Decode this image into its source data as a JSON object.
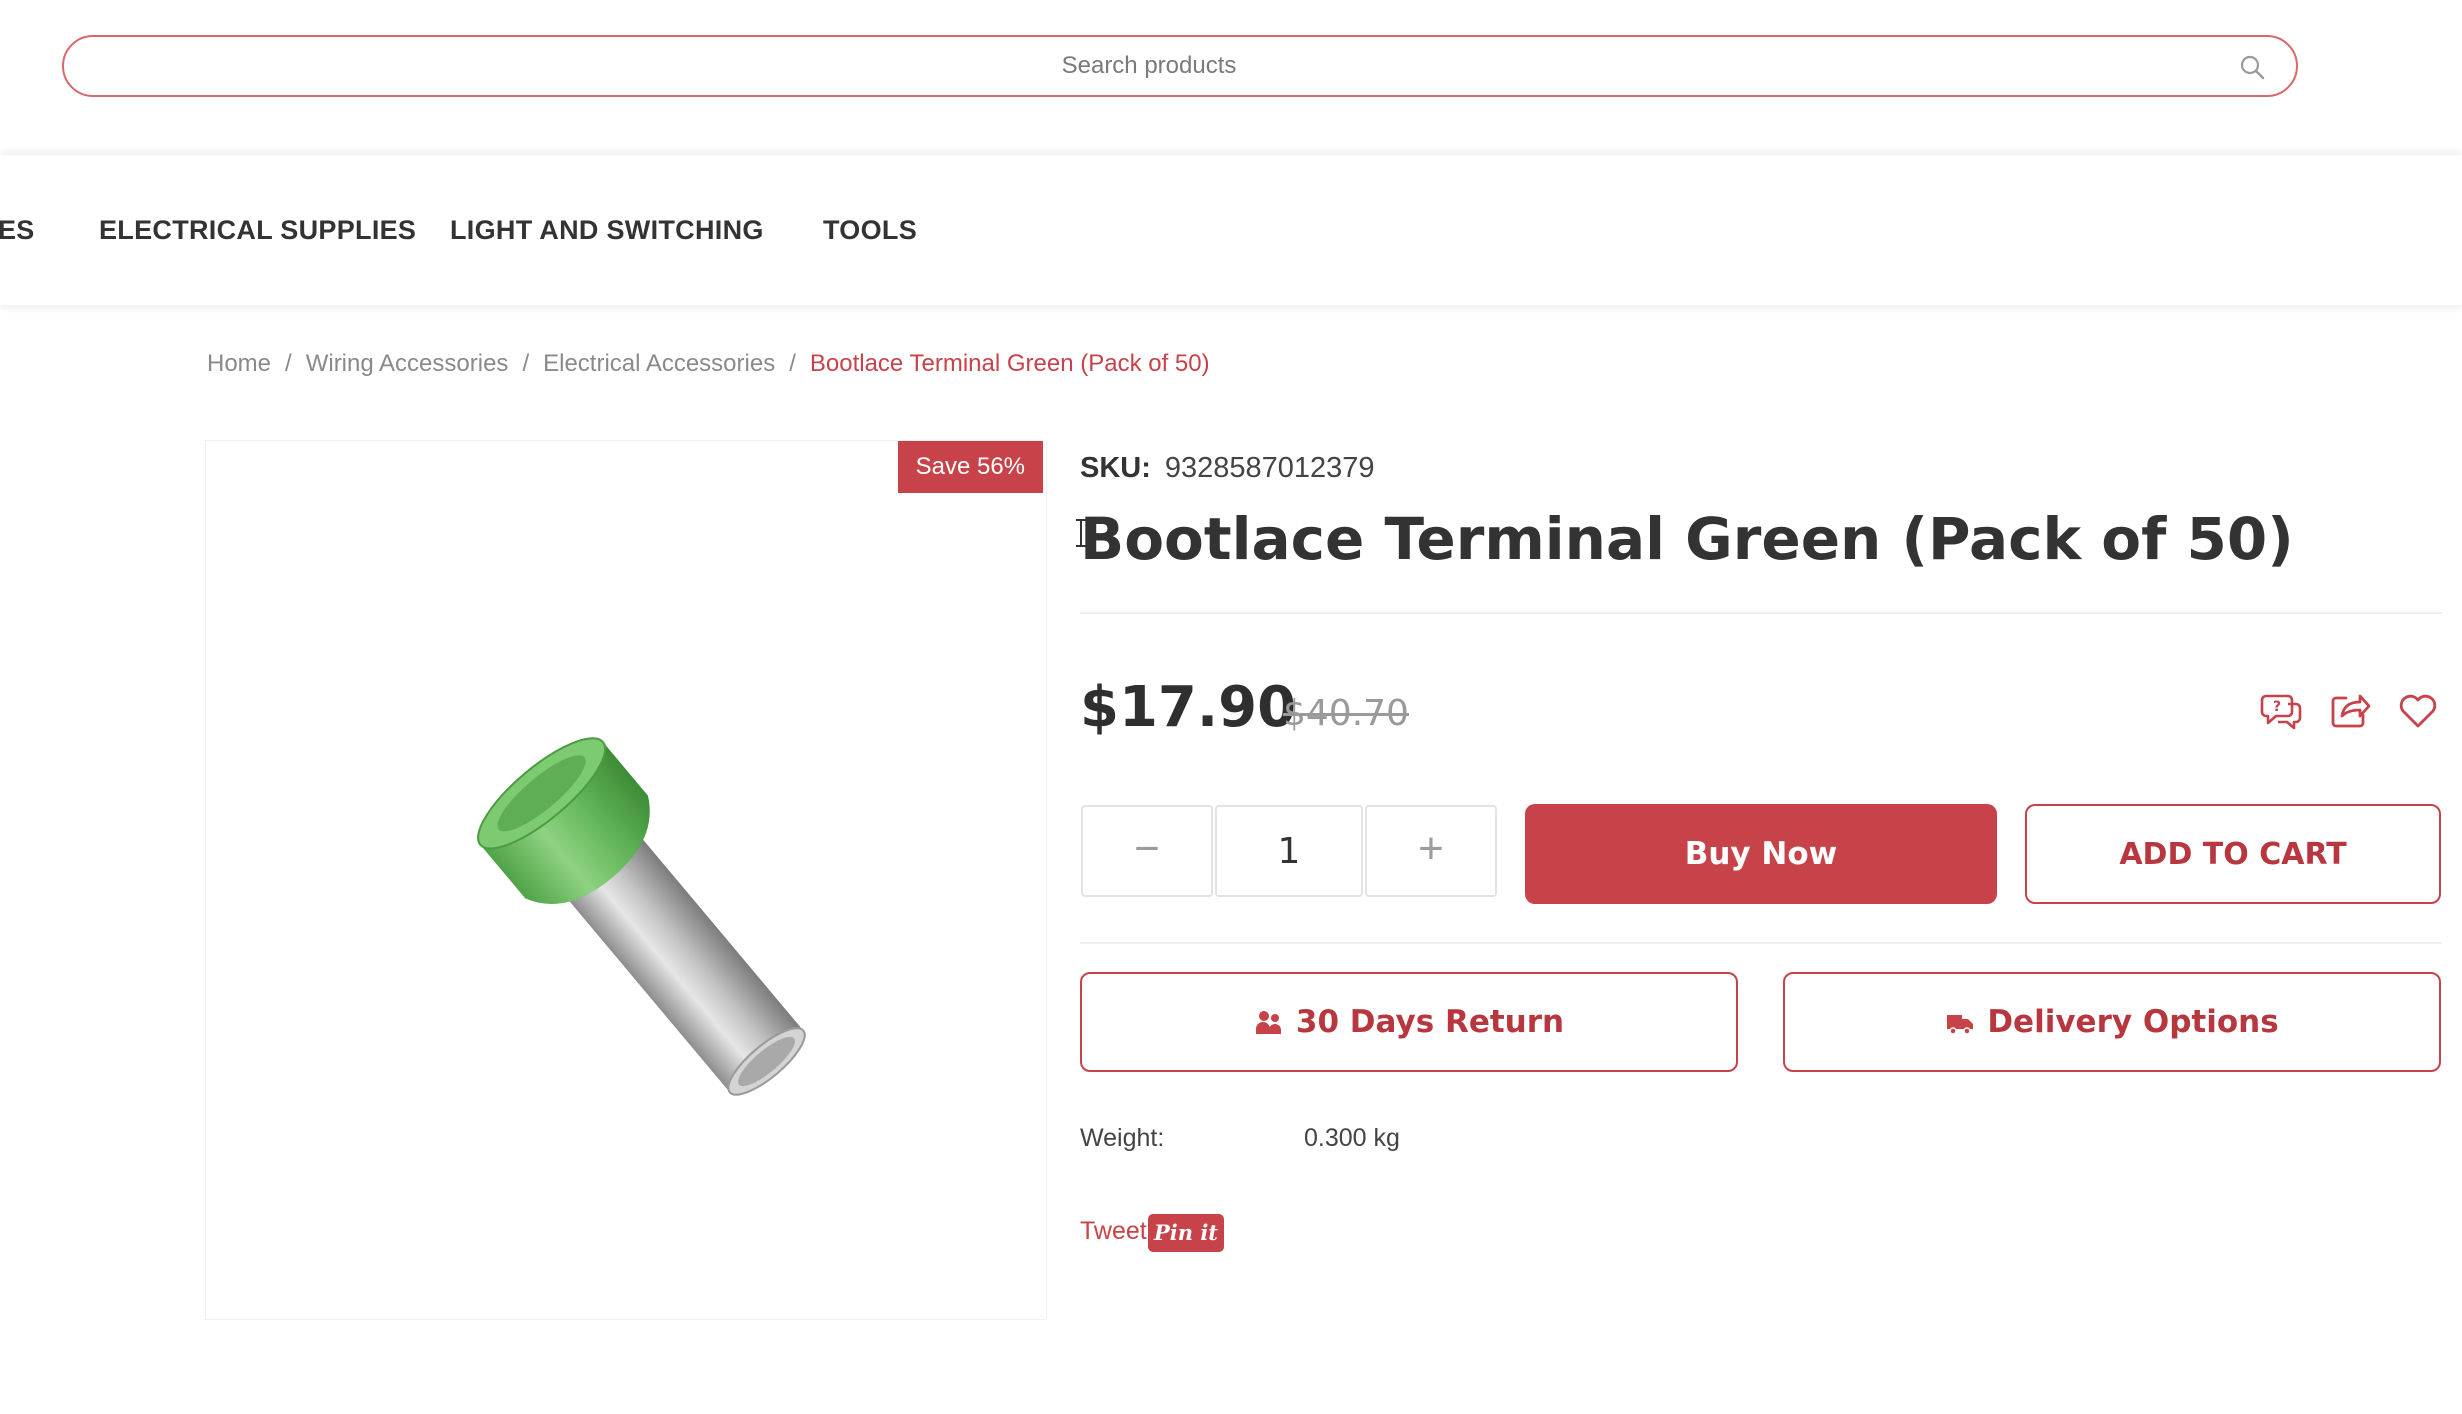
{
  "search": {
    "placeholder": "Search products"
  },
  "nav": {
    "items": [
      {
        "label": "ES"
      },
      {
        "label": "ELECTRICAL SUPPLIES"
      },
      {
        "label": "LIGHT AND SWITCHING"
      },
      {
        "label": "TOOLS"
      }
    ]
  },
  "breadcrumb": {
    "items": [
      "Home",
      "Wiring Accessories",
      "Electrical Accessories"
    ],
    "separator": "/",
    "current": "Bootlace Terminal Green (Pack of 50)"
  },
  "product": {
    "badge": "Save 56%",
    "sku_label": "SKU:",
    "sku": "9328587012379",
    "title": "Bootlace Terminal Green (Pack of 50)",
    "price": "$17.90",
    "old_price": "$40.70",
    "quantity": "1",
    "qty_minus": "−",
    "qty_plus": "+",
    "weight_label": "Weight:",
    "weight_value": "0.300 kg"
  },
  "actions": {
    "buy_now": "Buy Now",
    "add_to_cart": "ADD TO CART",
    "returns": "30 Days Return",
    "delivery": "Delivery Options"
  },
  "share": {
    "tweet": "Tweet",
    "pinit": "Pin it"
  },
  "icons": {
    "search": "search-icon",
    "question": "question-chat-icon",
    "share": "share-icon",
    "wishlist": "heart-icon",
    "returns": "people-icon",
    "delivery": "truck-icon"
  },
  "colors": {
    "accent": "#c8424a",
    "search_border": "#d9676b",
    "product_green": "#6abf5e",
    "product_metal": "#b8b8b8"
  }
}
